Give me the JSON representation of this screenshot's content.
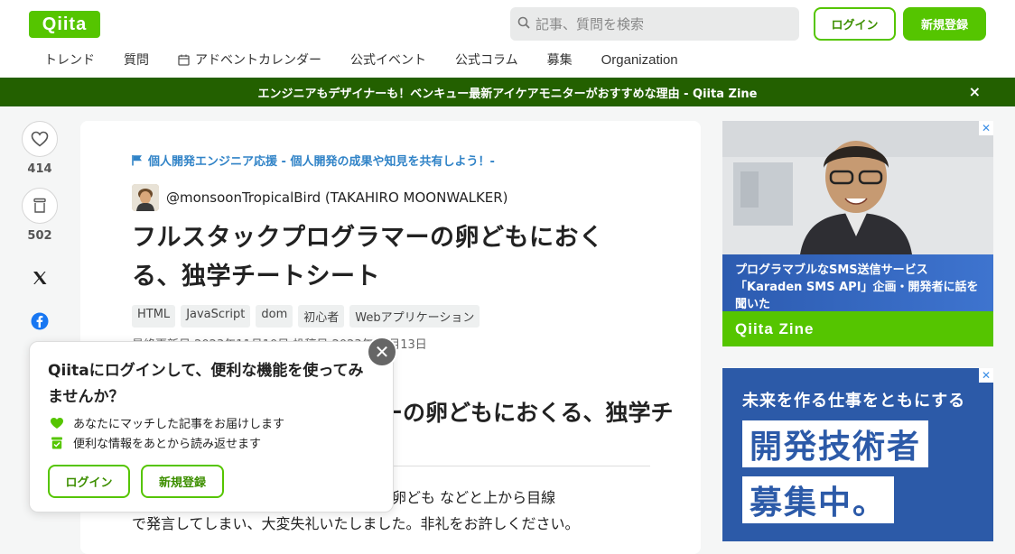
{
  "header": {
    "logo": "Qiita",
    "search_placeholder": "記事、質問を検索",
    "login_label": "ログイン",
    "signup_label": "新規登録",
    "nav": [
      {
        "label": "トレンド"
      },
      {
        "label": "質問"
      },
      {
        "label": "アドベントカレンダー",
        "icon": "calendar-icon"
      },
      {
        "label": "公式イベント"
      },
      {
        "label": "公式コラム"
      },
      {
        "label": "募集"
      },
      {
        "label": "Organization"
      }
    ]
  },
  "banner": {
    "text": "エンジニアもデザイナーも！ベンキュー最新アイケアモニターがおすすめな理由 - Qiita Zine",
    "close": "×"
  },
  "rail": {
    "likes": "414",
    "stocks": "502"
  },
  "article": {
    "org_link": "個人開発エンジニア応援 - 個人開発の成果や知見を共有しよう！-",
    "author": "@monsoonTropicalBird (TAKAHIRO MOONWALKER)",
    "title": "フルスタックプログラマーの卵どもにおくる、独学チートシート",
    "tags": [
      "HTML",
      "JavaScript",
      "dom",
      "初心者",
      "Webアプリケーション"
    ],
    "meta": "最終更新日 2023年11月10日  投稿日 2023年11月13日",
    "h1": "フルスタックプログラマーの卵どもにおくる、独学チ",
    "body_line1": "自分を独学・ゴミプログラマーの身分で卵ども などと上から目線",
    "body_line2": "で発言してしまい、大変失礼いたしました。非礼をお許しください。"
  },
  "popup": {
    "title": "Qiitaにログインして、便利な機能を使ってみませんか？",
    "features": [
      "あなたにマッチした記事をお届けします",
      "便利な情報をあとから読み返せます"
    ],
    "login_label": "ログイン",
    "signup_label": "新規登録",
    "close": "✕"
  },
  "ads": {
    "ad1_line1": "プログラマブルなSMS送信サービス",
    "ad1_line2": "「Karaden SMS API」企画・開発者に話を聞いた",
    "ad1_brand": "Qiita Zine",
    "ad2_line": "未来を作る仕事をともにする",
    "ad2_box1": "開発技術者",
    "ad2_box2": "募集中。"
  },
  "colors": {
    "brand_green": "#55c500",
    "banner_green": "#236000",
    "link_blue": "#3083c7"
  }
}
